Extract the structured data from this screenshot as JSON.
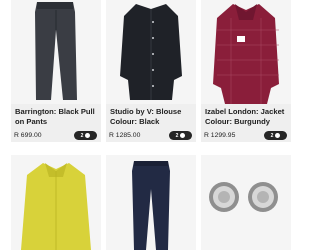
{
  "products": [
    {
      "name": "Barrington: Black Pull on Pants",
      "price": "R 699.00",
      "badge": "2"
    },
    {
      "name": "Studio by V: Blouse Colour: Black",
      "price": "R 1285.00",
      "badge": "2"
    },
    {
      "name": "Izabel London: Jacket Colour: Burgundy",
      "price": "R 1299.95",
      "badge": "2"
    }
  ],
  "colors": {
    "pants": "#3a3d44",
    "blouse": "#1f2228",
    "jacket": "#8a1e3a",
    "yellow": "#d8d23a",
    "jeans": "#222a44",
    "earring": "#9a9a9a"
  }
}
